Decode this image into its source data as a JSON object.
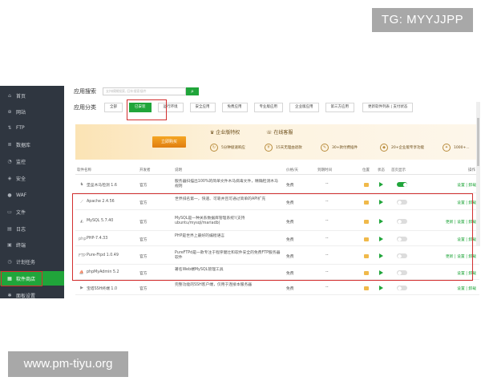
{
  "watermark": {
    "top": "TG: MYYJJPP",
    "bottom": "www.pm-tiyu.org"
  },
  "sidebar": {
    "items": [
      {
        "icon": "home-icon",
        "glyph": "⌂",
        "label": "首页"
      },
      {
        "icon": "globe-icon",
        "glyph": "⊕",
        "label": "网站"
      },
      {
        "icon": "ftp-icon",
        "glyph": "⇅",
        "label": "FTP"
      },
      {
        "icon": "database-icon",
        "glyph": "≣",
        "label": "数据库"
      },
      {
        "icon": "monitor-icon",
        "glyph": "◔",
        "label": "监控"
      },
      {
        "icon": "shield-icon",
        "glyph": "◈",
        "label": "安全"
      },
      {
        "icon": "waf-icon",
        "glyph": "●",
        "label": "WAF"
      },
      {
        "icon": "folder-icon",
        "glyph": "▭",
        "label": "文件"
      },
      {
        "icon": "log-icon",
        "glyph": "▤",
        "label": "日志"
      },
      {
        "icon": "terminal-icon",
        "glyph": "▣",
        "label": "终端"
      },
      {
        "icon": "clock-icon",
        "glyph": "◷",
        "label": "计划任务"
      },
      {
        "icon": "grid-icon",
        "glyph": "▦",
        "label": "软件商店"
      },
      {
        "icon": "gear-icon",
        "glyph": "✱",
        "label": "面板设置"
      }
    ]
  },
  "search": {
    "label": "应用搜索",
    "placeholder": "支持模糊搜索, 回车搜索插件",
    "button_glyph": "⌕"
  },
  "categories": {
    "label": "应用分类",
    "items": [
      "全部",
      "已安装",
      "运行环境",
      "安全应用",
      "免费应用",
      "专业版应用",
      "企业版应用",
      "第三方应用"
    ],
    "update_button": "更新软件列表 | 支付状态"
  },
  "banner": {
    "tag": "立即购买",
    "title": "企业版特权",
    "title2": "在线客服",
    "features": [
      "5分钟极速响应",
      "15天无理由退款",
      "30+款付费插件",
      "20+企业版专享功能",
      "1000+..."
    ]
  },
  "table": {
    "headers": [
      "软件名称",
      "开发者",
      "说明",
      "价格/天",
      "到期时间",
      "位置",
      "状态",
      "首页显示",
      "操作"
    ],
    "rows": [
      {
        "icon": "trojan-icon",
        "glyph": "♞",
        "name": "堡垒木马检测 1.6",
        "dev": "官方",
        "desc": "服务器扫描出100%的简单文件木马病毒文件，精确检测木马规则",
        "price": "免费",
        "expire": "--",
        "home_on": true,
        "ops": "设置 | 卸载"
      },
      {
        "icon": "apache-icon",
        "glyph": "⟋",
        "name": "Apache 2.4.56",
        "dev": "官方",
        "desc": "世界排名第一，快速、可靠并且可通过简单的API扩充",
        "price": "免费",
        "expire": "--",
        "home_on": false,
        "ops": "设置 | 卸载"
      },
      {
        "icon": "mysql-icon",
        "glyph": "◭",
        "name": "MySQL 5.7.40",
        "dev": "官方",
        "desc": "MySQL是一种关系数据库管理系统!(支持ubuntu/mysql/mariadb)",
        "price": "免费",
        "expire": "--",
        "home_on": false,
        "ops": "更新 | 设置 | 卸载"
      },
      {
        "icon": "php-icon",
        "glyph": "php",
        "name": "PHP-7.4.33",
        "dev": "官方",
        "desc": "PHP是世界上最好的编程语言",
        "price": "免费",
        "expire": "--",
        "home_on": false,
        "ops": "设置 | 卸载"
      },
      {
        "icon": "pureftp-icon",
        "glyph": "FTP",
        "name": "Pure-Ftpd 1.0.49",
        "dev": "官方",
        "desc": "PureFTPd是一款专注于程序健壮和软件安全的免费FTP服务器软件",
        "price": "免费",
        "expire": "--",
        "home_on": false,
        "ops": "更新 | 设置 | 卸载"
      },
      {
        "icon": "phpmyadmin-icon",
        "glyph": "⛵",
        "name": "phpMyAdmin 5.2",
        "dev": "官方",
        "desc": "著名Web端MySQL管理工具",
        "price": "免费",
        "expire": "--",
        "home_on": false,
        "ops": "设置 | 卸载"
      },
      {
        "icon": "ssh-icon",
        "glyph": "▶",
        "name": "宝塔SSH终端 1.0",
        "dev": "官方",
        "desc": "完整功能的SSH客户端，仅用于连接本服务器",
        "price": "免费",
        "expire": "--",
        "home_on": false,
        "ops": "设置 | 卸载"
      }
    ]
  },
  "colors": {
    "accent": "#20a53a",
    "highlight": "#d32f2f",
    "sidebar": "#2f3640"
  }
}
